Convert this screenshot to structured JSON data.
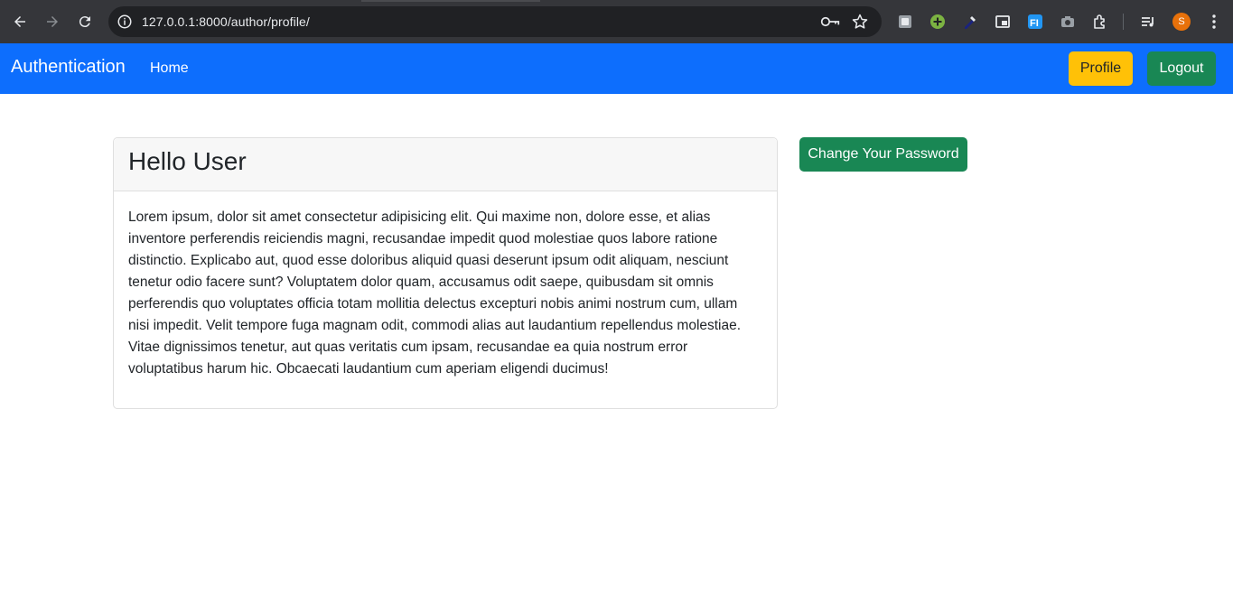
{
  "browser": {
    "url": "127.0.0.1:8000/author/profile/",
    "profile_initial": "S",
    "icons": {
      "back": "arrow-left-icon",
      "forward": "arrow-right-icon",
      "reload": "reload-icon",
      "site_info": "info-icon",
      "password_key": "key-icon",
      "bookmark": "star-icon",
      "extensions": [
        "extension-grey-icon",
        "extension-green-plus-icon",
        "extension-eyedropper-icon",
        "extension-window-icon",
        "extension-fi-icon",
        "extension-camera-icon",
        "puzzle-icon"
      ],
      "media": "media-queue-icon",
      "menu": "kebab-menu-icon"
    }
  },
  "navbar": {
    "brand": "Authentication",
    "home_link": "Home",
    "profile_button": "Profile",
    "logout_button": "Logout",
    "colors": {
      "bar": "#0d6efd",
      "profile": "#ffc107",
      "logout": "#198754"
    }
  },
  "card": {
    "title": "Hello User",
    "body": "Lorem ipsum, dolor sit amet consectetur adipisicing elit. Qui maxime non, dolore esse, et alias inventore perferendis reiciendis magni, recusandae impedit quod molestiae quos labore ratione distinctio. Explicabo aut, quod esse doloribus aliquid quasi deserunt ipsum odit aliquam, nesciunt tenetur odio facere sunt? Voluptatem dolor quam, accusamus odit saepe, quibusdam sit omnis perferendis quo voluptates officia totam mollitia delectus excepturi nobis animi nostrum cum, ullam nisi impedit. Velit tempore fuga magnam odit, commodi alias aut laudantium repellendus molestiae. Vitae dignissimos tenetur, aut quas veritatis cum ipsam, recusandae ea quia nostrum error voluptatibus harum hic. Obcaecati laudantium cum aperiam eligendi ducimus!"
  },
  "actions": {
    "change_password_button": "Change Your Password",
    "color": "#198754"
  }
}
